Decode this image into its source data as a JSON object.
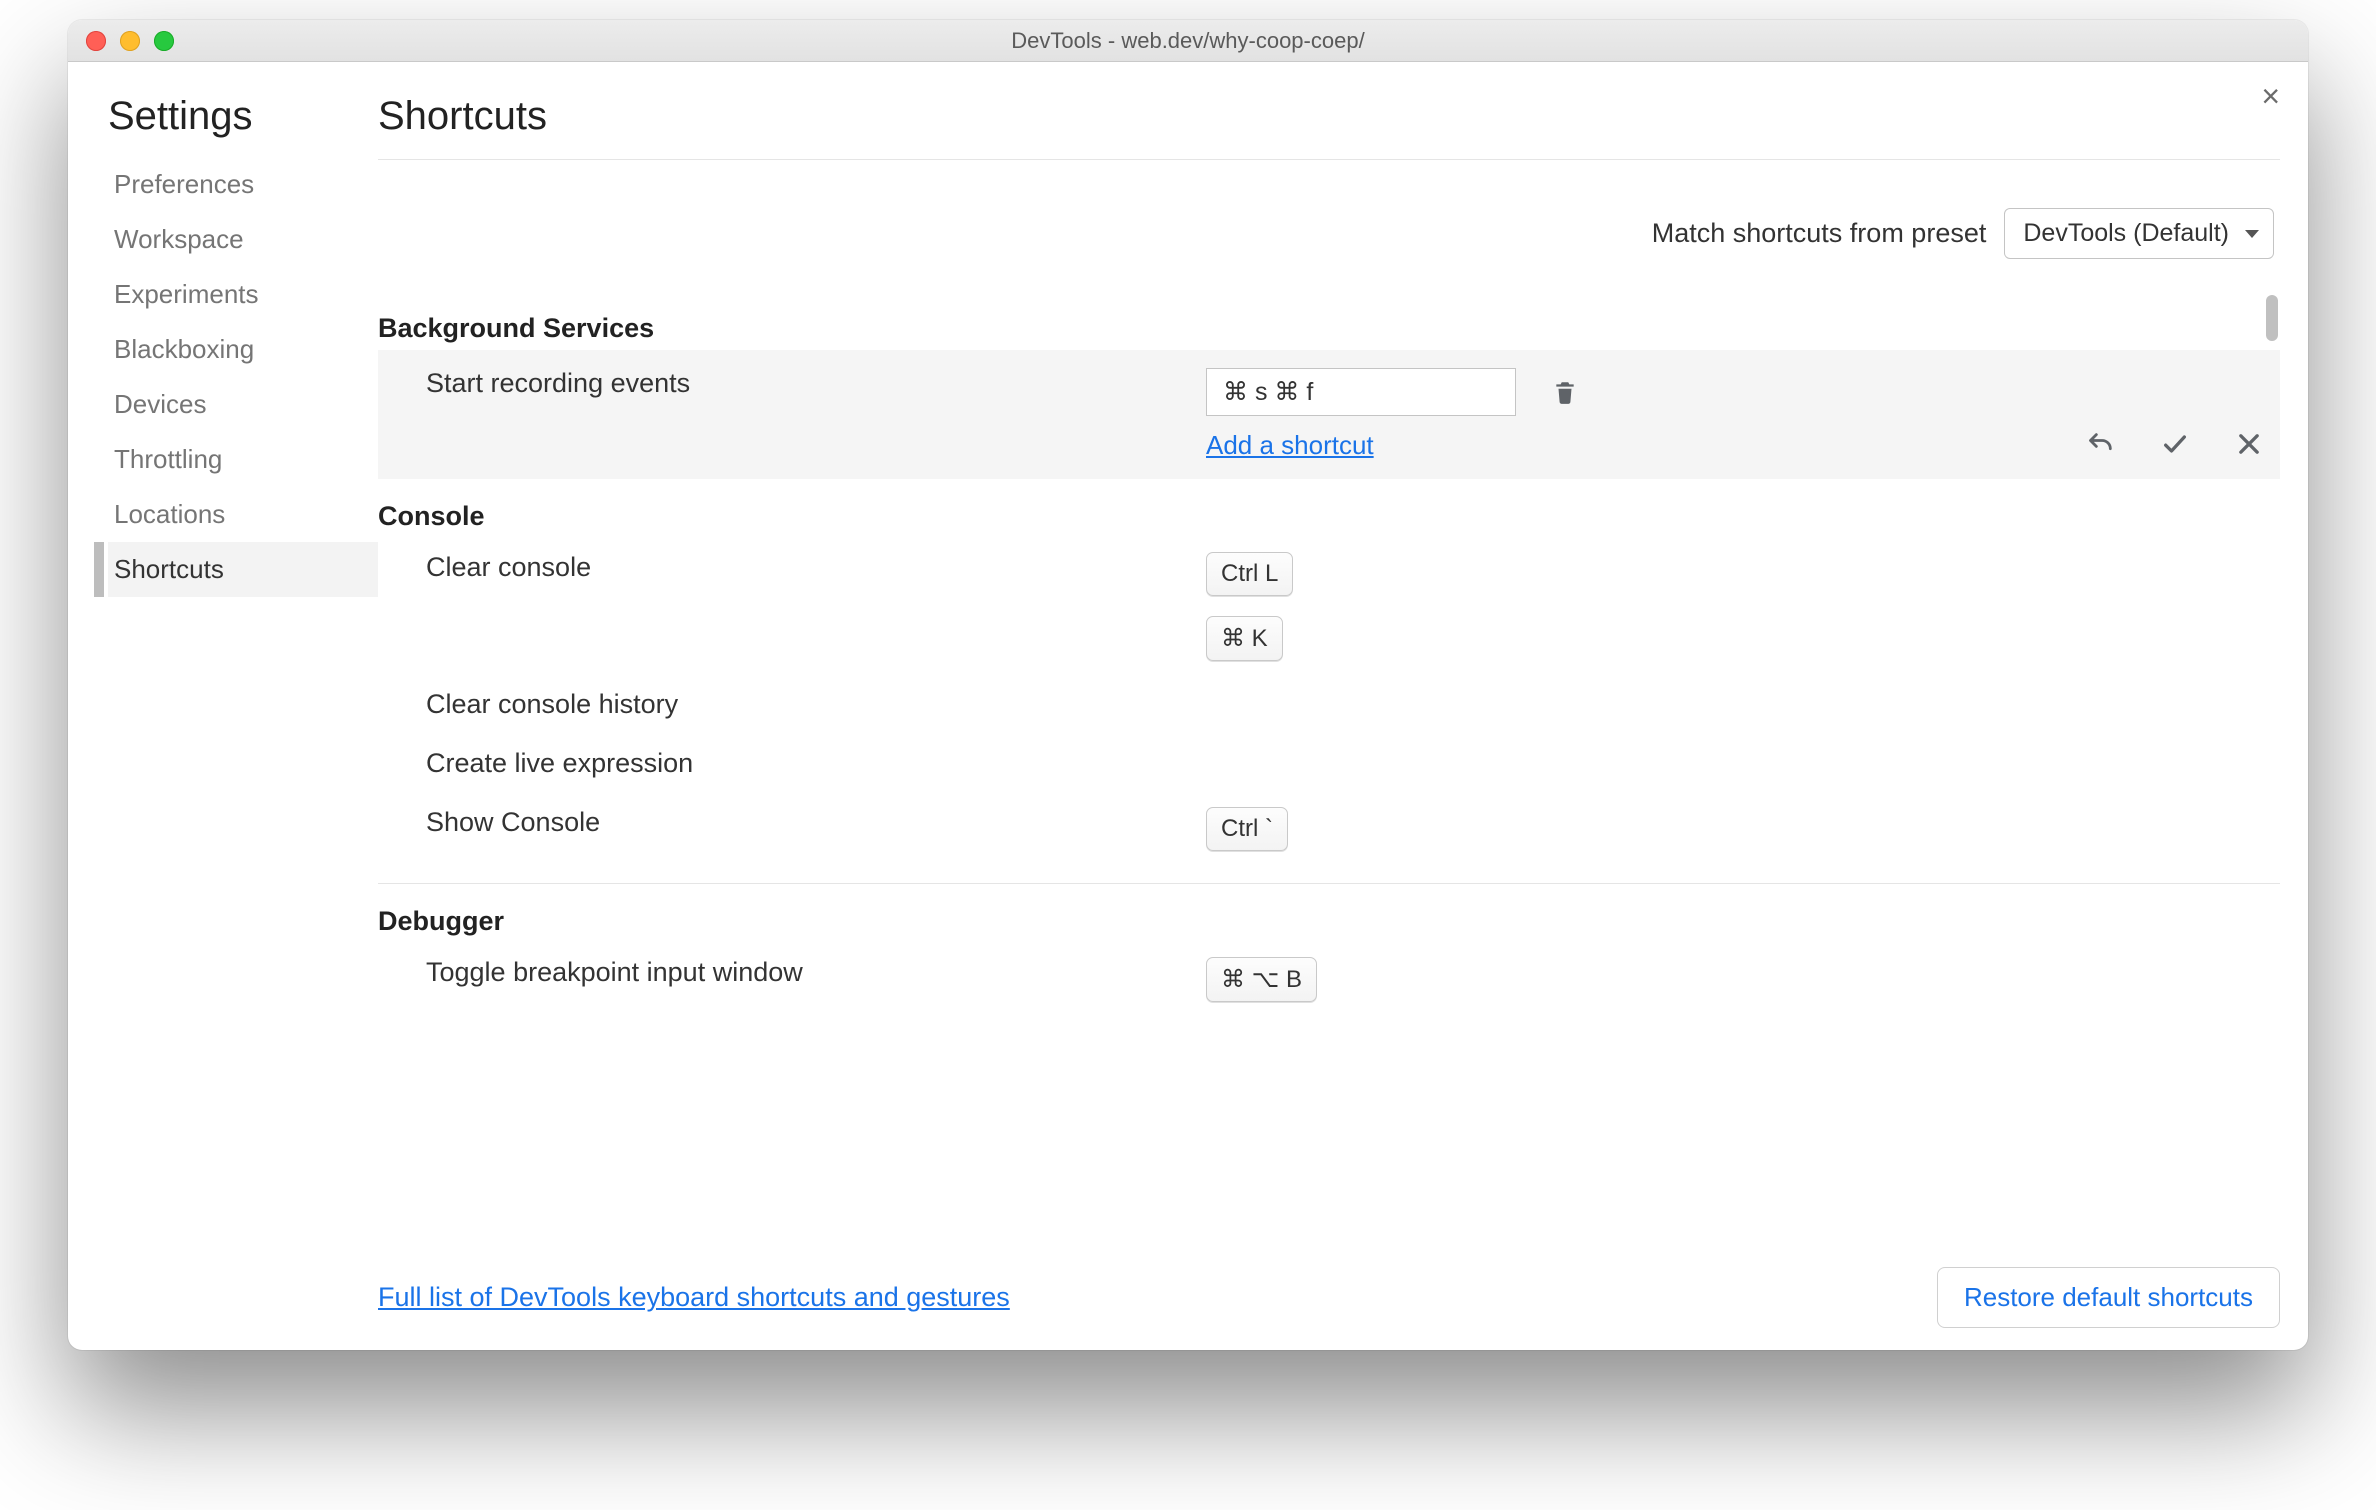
{
  "window": {
    "title": "DevTools - web.dev/why-coop-coep/"
  },
  "sidebar": {
    "heading": "Settings",
    "items": [
      {
        "label": "Preferences"
      },
      {
        "label": "Workspace"
      },
      {
        "label": "Experiments"
      },
      {
        "label": "Blackboxing"
      },
      {
        "label": "Devices"
      },
      {
        "label": "Throttling"
      },
      {
        "label": "Locations"
      },
      {
        "label": "Shortcuts"
      }
    ],
    "active_index": 7
  },
  "main": {
    "heading": "Shortcuts",
    "preset_label": "Match shortcuts from preset",
    "preset_value": "DevTools (Default)",
    "sections": {
      "background": {
        "title": "Background Services",
        "row0": {
          "label": "Start recording events",
          "input_value": "⌘ s ⌘ f",
          "add_link": "Add a shortcut"
        }
      },
      "console": {
        "title": "Console",
        "rows": [
          {
            "label": "Clear console",
            "keys": [
              "Ctrl L",
              "⌘ K"
            ]
          },
          {
            "label": "Clear console history"
          },
          {
            "label": "Create live expression"
          },
          {
            "label": "Show Console",
            "keys": [
              "Ctrl `"
            ]
          }
        ]
      },
      "debugger": {
        "title": "Debugger",
        "row0": {
          "label": "Toggle breakpoint input window",
          "key": "⌘ ⌥ B"
        }
      }
    }
  },
  "footer": {
    "link": "Full list of DevTools keyboard shortcuts and gestures",
    "restore": "Restore default shortcuts"
  }
}
